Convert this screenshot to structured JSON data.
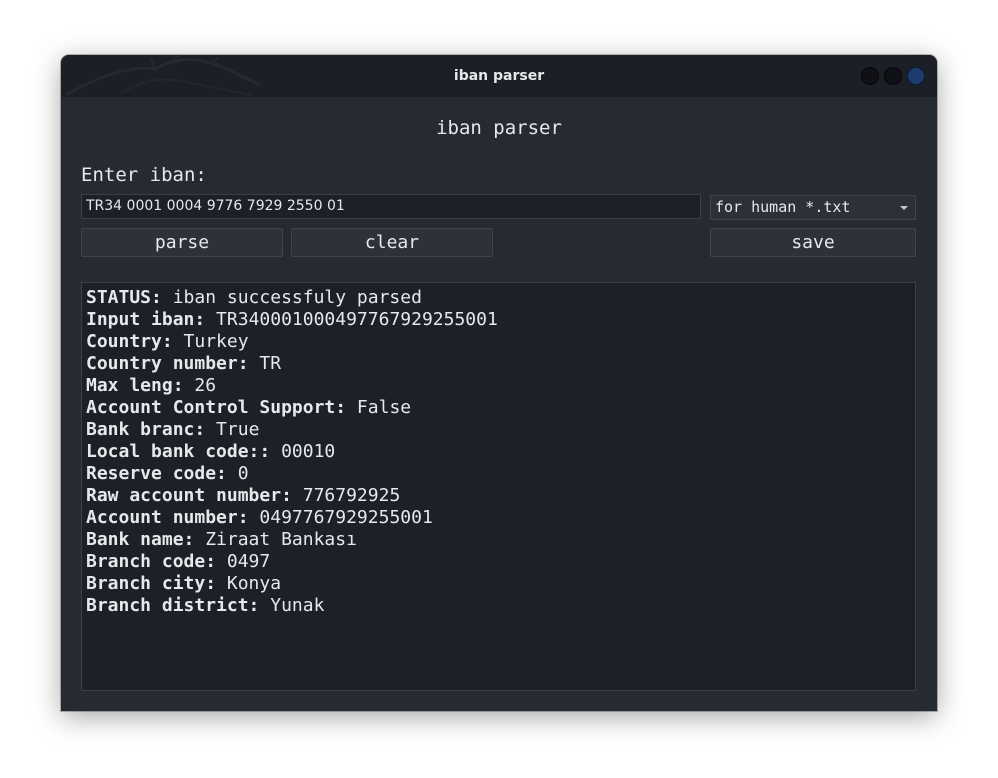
{
  "window": {
    "title": "iban parser"
  },
  "heading": "iban parser",
  "prompt": "Enter iban:",
  "iban_input": {
    "value": "TR34 0001 0004 9776 7929 2550 01"
  },
  "format_select": {
    "selected": "for human *.txt"
  },
  "buttons": {
    "parse": "parse",
    "clear": "clear",
    "save": "save"
  },
  "output": {
    "lines": [
      {
        "key": "STATUS:",
        "value": " iban successfuly parsed"
      },
      {
        "key": "Input iban:",
        "value": " TR340001000497767929255001"
      },
      {
        "key": "Country:",
        "value": " Turkey"
      },
      {
        "key": "Country number:",
        "value": " TR"
      },
      {
        "key": "Max leng:",
        "value": " 26"
      },
      {
        "key": "Account Control Support:",
        "value": " False"
      },
      {
        "key": "Bank branc:",
        "value": " True"
      },
      {
        "key": "Local bank code::",
        "value": " 00010"
      },
      {
        "key": "Reserve code:",
        "value": " 0"
      },
      {
        "key": "Raw account number:",
        "value": " 776792925"
      },
      {
        "key": "Account number:",
        "value": " 0497767929255001"
      },
      {
        "key": "Bank name:",
        "value": " Ziraat Bankası"
      },
      {
        "key": "Branch code:",
        "value": " 0497"
      },
      {
        "key": "Branch city:",
        "value": " Konya"
      },
      {
        "key": "Branch district:",
        "value": " Yunak"
      }
    ]
  },
  "colors": {
    "window_bg": "#262a33",
    "titlebar_bg": "#1c1f26",
    "text": "#e6e8ec",
    "close_button": "#1e3d6e"
  },
  "icons": {
    "titlebar_art": "dragon-icon",
    "minimize": "minimize-icon",
    "maximize": "maximize-icon",
    "close": "close-icon",
    "dropdown": "chevron-down-icon"
  }
}
